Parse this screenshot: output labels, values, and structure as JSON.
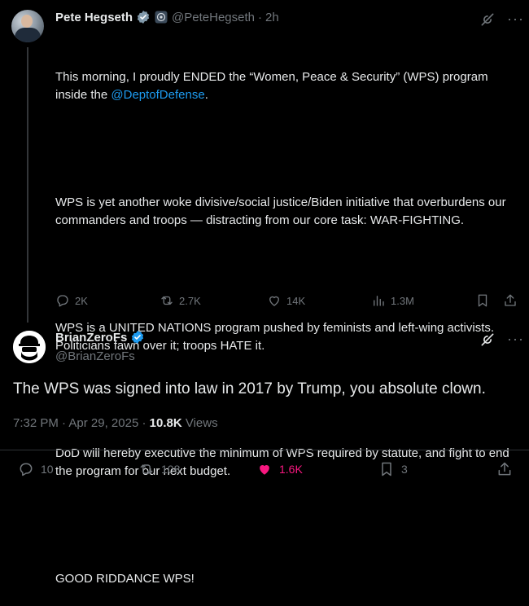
{
  "original_tweet": {
    "author_name": "Pete Hegseth",
    "handle": "@PeteHegseth",
    "time": "2h",
    "paragraphs": [
      {
        "before": "This morning, I proudly ENDED the “Women, Peace & Security” (WPS) program inside the ",
        "mention": "@DeptofDefense",
        "after": "."
      },
      {
        "text": "WPS is yet another woke divisive/social justice/Biden initiative that overburdens our commanders and troops — distracting from our core task: WAR-FIGHTING."
      },
      {
        "text": "WPS is a UNITED NATIONS program pushed by feminists and left-wing activists. Politicians fawn over it; troops HATE it."
      },
      {
        "text": "DoD will hereby executive the minimum of WPS required by statute, and fight to end the program for our next budget."
      },
      {
        "text": "GOOD RIDDANCE WPS!"
      }
    ],
    "stats": {
      "replies": "2K",
      "reposts": "2.7K",
      "likes": "14K",
      "views": "1.3M"
    }
  },
  "reply_tweet": {
    "author_name": "BrianZeroFs",
    "handle": "@BrianZeroFs",
    "text": "The WPS was signed into law in 2017 by Trump, you absolute clown.",
    "time": "7:32 PM",
    "date": "Apr 29, 2025",
    "views_count": "10.8K",
    "views_label": "Views",
    "stats": {
      "replies": "10",
      "reposts": "108",
      "likes": "1.6K",
      "bookmarks": "3"
    }
  },
  "colors": {
    "accent": "#1d9bf0",
    "like_active": "#f91880",
    "muted": "#71767b",
    "text": "#e7e9ea",
    "background": "#000000"
  },
  "icons": [
    "verified-badge-icon",
    "affiliate-badge-icon",
    "grok-icon",
    "more-icon",
    "reply-icon",
    "repost-icon",
    "like-icon",
    "views-icon",
    "bookmark-icon",
    "share-icon"
  ]
}
